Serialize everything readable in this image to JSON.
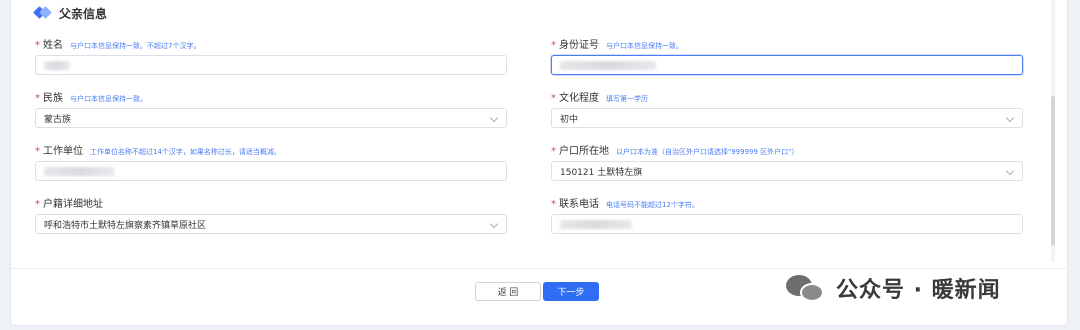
{
  "section": {
    "title": "父亲信息"
  },
  "fields": {
    "name": {
      "required": "*",
      "label": "姓名",
      "hint": "与户口本信息保持一致。不超过7个汉字。",
      "value": ""
    },
    "id_number": {
      "required": "*",
      "label": "身份证号",
      "hint": "与户口本信息保持一致。",
      "value": ""
    },
    "ethnicity": {
      "required": "*",
      "label": "民族",
      "hint": "与户口本信息保持一致。",
      "value": "蒙古族"
    },
    "education": {
      "required": "*",
      "label": "文化程度",
      "hint": "填写第一学历",
      "value": "初中"
    },
    "workplace": {
      "required": "*",
      "label": "工作单位",
      "hint": "工作单位名称不超过14个汉字，如果名称过长，请适当概减。",
      "value": ""
    },
    "hukou_location": {
      "required": "*",
      "label": "户口所在地",
      "hint": "以户口本为准（自治区外户口请选择\"999999 区外户口\"）",
      "value": "150121 土默特左旗"
    },
    "hukou_address": {
      "required": "*",
      "label": "户籍详细地址",
      "hint": "",
      "value": "呼和浩特市土默特左旗察素齐镇草原社区"
    },
    "phone": {
      "required": "*",
      "label": "联系电话",
      "hint": "电话号码不能超过12个字符。",
      "value": ""
    }
  },
  "buttons": {
    "back": "返 回",
    "next": "下一步"
  },
  "watermark": {
    "text": "公众号 · 暖新闻",
    "icon": "wechat-icon"
  },
  "colors": {
    "accent": "#2f6df5",
    "required": "#e2463e",
    "hint": "#4a7cf2"
  }
}
